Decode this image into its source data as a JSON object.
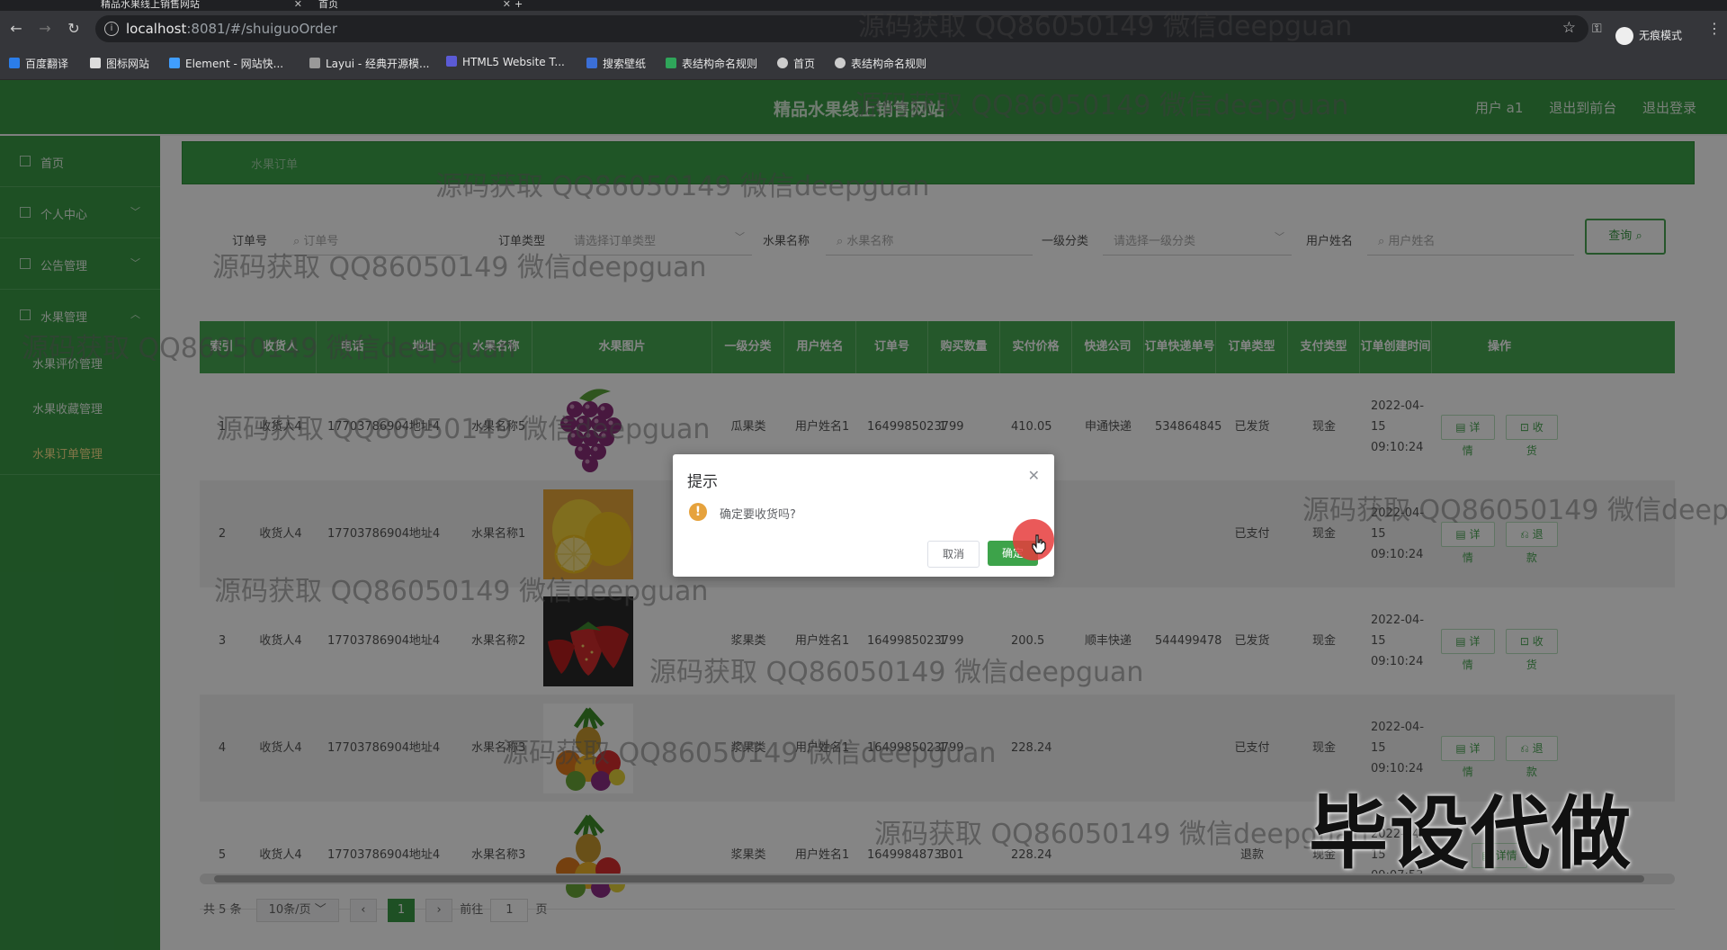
{
  "browser": {
    "tabs": [
      {
        "label": "精品水果线上销售网站"
      },
      {
        "label": "首页"
      }
    ],
    "url_host": "localhost",
    "url_rest": ":8081/#/shuiguoOrder",
    "incognito_label": "无痕模式",
    "bookmarks": [
      "百度翻译",
      "图标网站",
      "Element - 网站快...",
      "Layui - 经典开源模...",
      "HTML5 Website T...",
      "搜索壁纸",
      "表结构命名规则",
      "首页",
      "表结构命名规则"
    ]
  },
  "header": {
    "title": "精品水果线上销售网站",
    "links": [
      "用户 a1",
      "退出到前台",
      "退出登录"
    ]
  },
  "sidebar": {
    "items": [
      {
        "label": "首页"
      },
      {
        "label": "个人中心"
      },
      {
        "label": "公告管理"
      },
      {
        "label": "水果管理"
      }
    ],
    "subitems": [
      {
        "label": "水果评价管理"
      },
      {
        "label": "水果收藏管理"
      },
      {
        "label": "水果订单管理"
      }
    ]
  },
  "breadcrumb": "水果订单",
  "search": {
    "fields": [
      {
        "label": "订单号",
        "placeholder": "订单号"
      },
      {
        "label": "订单类型",
        "placeholder": "请选择订单类型"
      },
      {
        "label": "水果名称",
        "placeholder": "水果名称"
      },
      {
        "label": "一级分类",
        "placeholder": "请选择一级分类"
      },
      {
        "label": "用户姓名",
        "placeholder": "用户姓名"
      }
    ],
    "query_button": "查询"
  },
  "table": {
    "headers": [
      "索引",
      "收货人",
      "电话",
      "地址",
      "水果名称",
      "水果图片",
      "一级分类",
      "用户姓名",
      "订单号",
      "购买数量",
      "实付价格",
      "快递公司",
      "订单快递单号",
      "订单类型",
      "支付类型",
      "订单创建时间",
      "操作"
    ],
    "rows": [
      {
        "index": "1",
        "receiver": "收货人4",
        "phone": "17703786904",
        "address": "地址4",
        "fruit": "水果名称5",
        "fruit_icon": "grape-image",
        "category": "瓜果类",
        "user": "用户姓名1",
        "order_no": "1649985023799",
        "qty": "1",
        "price": "410.05",
        "courier": "申通快递",
        "tracking": "534864845",
        "order_type": "已发货",
        "pay": "现金",
        "created": "2022-04-15 09:10:24",
        "actions": [
          "详情",
          "收货"
        ]
      },
      {
        "index": "2",
        "receiver": "收货人4",
        "phone": "17703786904",
        "address": "地址4",
        "fruit": "水果名称1",
        "fruit_icon": "lemon-image",
        "category": "",
        "user": "",
        "order_no": "",
        "qty": "",
        "price": "",
        "courier": "",
        "tracking": "",
        "order_type": "已支付",
        "pay": "现金",
        "created": "2022-04-15 09:10:24",
        "actions": [
          "详情",
          "退款"
        ]
      },
      {
        "index": "3",
        "receiver": "收货人4",
        "phone": "17703786904",
        "address": "地址4",
        "fruit": "水果名称2",
        "fruit_icon": "strawberry-image",
        "category": "浆果类",
        "user": "用户姓名1",
        "order_no": "1649985023799",
        "qty": "1",
        "price": "200.5",
        "courier": "顺丰快递",
        "tracking": "544499478",
        "order_type": "已发货",
        "pay": "现金",
        "created": "2022-04-15 09:10:24",
        "actions": [
          "详情",
          "收货"
        ]
      },
      {
        "index": "4",
        "receiver": "收货人4",
        "phone": "17703786904",
        "address": "地址4",
        "fruit": "水果名称3",
        "fruit_icon": "mixed-fruit-image",
        "category": "浆果类",
        "user": "用户姓名1",
        "order_no": "1649985023799",
        "qty": "1",
        "price": "228.24",
        "courier": "",
        "tracking": "",
        "order_type": "已支付",
        "pay": "现金",
        "created": "2022-04-15 09:10:24",
        "actions": [
          "详情",
          "退款"
        ]
      },
      {
        "index": "5",
        "receiver": "收货人4",
        "phone": "17703786904",
        "address": "地址4",
        "fruit": "水果名称3",
        "fruit_icon": "mixed-fruit-image",
        "category": "浆果类",
        "user": "用户姓名1",
        "order_no": "1649984873301",
        "qty": "1",
        "price": "228.24",
        "courier": "",
        "tracking": "",
        "order_type": "退款",
        "pay": "现金",
        "created": "2022-04-15 09:07:53",
        "actions": [
          "详情"
        ]
      }
    ]
  },
  "pager": {
    "total": "共 5 条",
    "page_size": "10条/页",
    "current": "1",
    "goto_label": "前往",
    "goto_value": "1",
    "page_unit": "页"
  },
  "dialog": {
    "title": "提示",
    "message": "确定要收货吗?",
    "cancel": "取消",
    "confirm": "确定"
  },
  "watermark_text": "源码获取 QQ86050149 微信deepguan",
  "stamp_text": "毕设代做",
  "colors": {
    "brand_green": "#3a9a46",
    "header_green": "#48a954",
    "warning": "#e6a23c"
  }
}
